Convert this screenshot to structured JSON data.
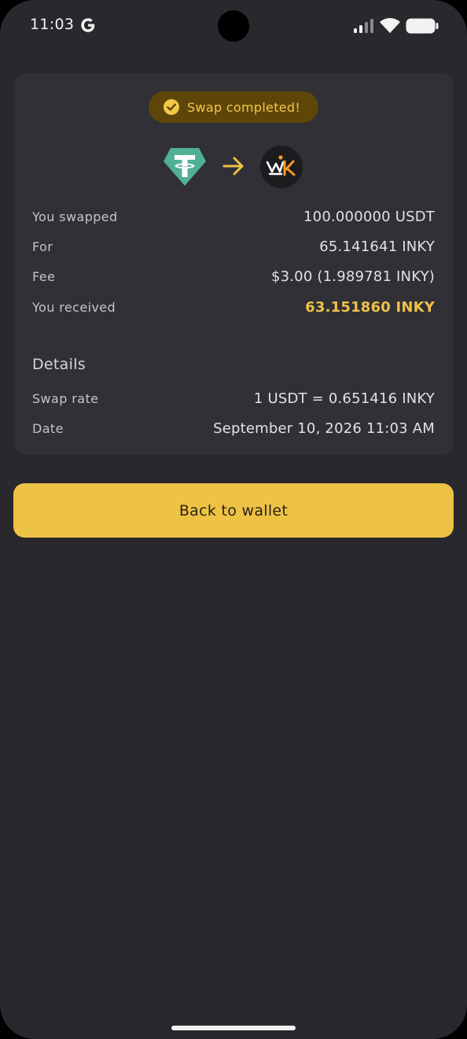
{
  "status_bar": {
    "time": "11:03"
  },
  "badge": {
    "label": "Swap completed!",
    "icon": "check-circle-icon"
  },
  "tokens": {
    "from_icon": "usdt-token-icon",
    "arrow_icon": "arrow-right-icon",
    "to_icon": "inky-token-icon"
  },
  "summary": [
    {
      "label": "You swapped",
      "value": "100.000000 USDT"
    },
    {
      "label": "For",
      "value": "65.141641 INKY"
    },
    {
      "label": "Fee",
      "value": "$3.00 (1.989781 INKY)"
    },
    {
      "label": "You received",
      "value": "63.151860 INKY"
    }
  ],
  "details": {
    "heading": "Details",
    "rows": [
      {
        "label": "Swap rate",
        "value": "1 USDT = 0.651416 INKY"
      },
      {
        "label": "Date",
        "value": "September 10, 2026 11:03 AM"
      }
    ]
  },
  "actions": {
    "back_label": "Back to wallet"
  },
  "colors": {
    "background": "#28282d",
    "card": "#303036",
    "accent": "#eec244",
    "badge_bg": "#5d4608",
    "tether_green": "#50af95"
  }
}
